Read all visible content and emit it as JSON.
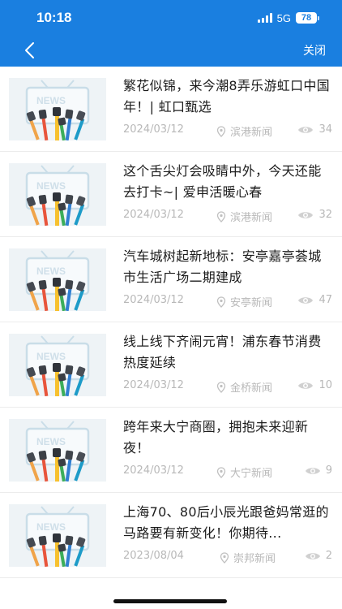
{
  "status": {
    "time": "10:18",
    "network": "5G",
    "battery": "78"
  },
  "nav": {
    "close_label": "关闭",
    "back_icon": "chevron-left-icon"
  },
  "colors": {
    "primary": "#1a7fe0",
    "meta_text": "#b8b8b8",
    "title_text": "#1c1c1c"
  },
  "articles": [
    {
      "title": "繁花似锦，来今潮8弄乐游虹口中国年！| 虹口甄选",
      "date": "2024/03/12",
      "source": "滨港新闻",
      "views": "34",
      "image": "news-thumbnail"
    },
    {
      "title": "这个舌尖灯会吸睛中外，今天还能去打卡~| 爱申活暖心春",
      "date": "2024/03/12",
      "source": "滨港新闻",
      "views": "32",
      "image": "news-thumbnail"
    },
    {
      "title": "汽车城树起新地标：安亭嘉亭荟城市生活广场二期建成",
      "date": "2024/03/12",
      "source": "安亭新闻",
      "views": "47",
      "image": "news-thumbnail"
    },
    {
      "title": "线上线下齐闹元宵！浦东春节消费热度延续",
      "date": "2024/03/12",
      "source": "金桥新闻",
      "views": "10",
      "image": "news-thumbnail"
    },
    {
      "title": "跨年来大宁商圈，拥抱未来迎新夜！",
      "date": "2024/03/12",
      "source": "大宁新闻",
      "views": "9",
      "image": "news-thumbnail"
    },
    {
      "title": "上海70、80后小辰光跟爸妈常逛的马路要有新变化！你期待...",
      "date": "2023/08/04",
      "source": "崇邦新闻",
      "views": "2",
      "image": "news-thumbnail"
    }
  ]
}
